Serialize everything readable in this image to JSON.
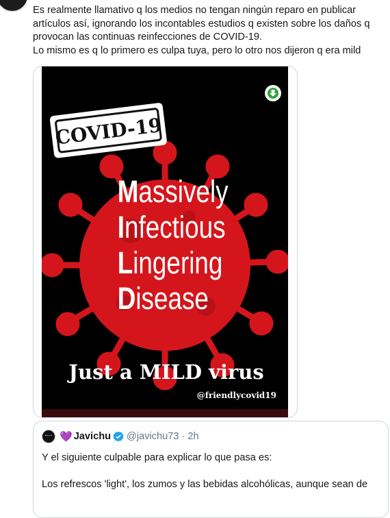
{
  "tweet": {
    "lines": [
      "Es realmente llamativo q los medios no tengan ningún reparo en publicar",
      "artículos así, ignorando los incontables estudios q existen sobre los daños q",
      "provocan las continuas reinfecciones de COVID-19.",
      "Lo mismo es q lo primero es culpa tuya, pero lo otro nos dijeron q era mild"
    ]
  },
  "poster": {
    "stamp": "COVID-19",
    "line1": {
      "first": "M",
      "rest": "assively"
    },
    "line2": {
      "first": "I",
      "rest": "nfectious"
    },
    "line3": {
      "first": "L",
      "rest": "ingering"
    },
    "line4": {
      "first": "D",
      "rest": "isease"
    },
    "tagline": "Just a MILD virus",
    "credit": "@friendlycovid19"
  },
  "quote": {
    "heart": "💜",
    "name": "Javichu",
    "handle": "@javichu73",
    "separator": "·",
    "time": "2h",
    "paragraph1": "Y el siguiente culpable para explicar lo que pasa es:",
    "paragraph2": "Los refrescos 'light', los zumos y las bebidas alcohólicas, aunque sean de"
  },
  "colors": {
    "virus_red": "#d4161c",
    "poster_bg": "#000000",
    "download_green": "#2fa33b",
    "verified_blue": "#1da1f2",
    "heart_purple": "#8e6bd6"
  },
  "icons": {
    "download": "download-arrow-icon",
    "verified": "verified-badge-icon"
  }
}
